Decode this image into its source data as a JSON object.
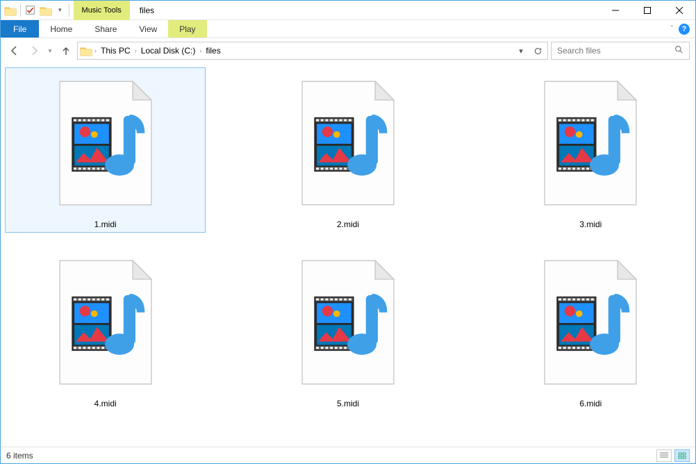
{
  "title_bar": {
    "contextual_tab_label": "Music Tools",
    "title": "files"
  },
  "ribbon": {
    "file": "File",
    "home": "Home",
    "share": "Share",
    "view": "View",
    "play": "Play"
  },
  "nav": {
    "breadcrumb": [
      {
        "label": "This PC"
      },
      {
        "label": "Local Disk (C:)"
      },
      {
        "label": "files"
      }
    ],
    "search_placeholder": "Search files"
  },
  "files": [
    {
      "name": "1.midi",
      "selected": true
    },
    {
      "name": "2.midi",
      "selected": false
    },
    {
      "name": "3.midi",
      "selected": false
    },
    {
      "name": "4.midi",
      "selected": false
    },
    {
      "name": "5.midi",
      "selected": false
    },
    {
      "name": "6.midi",
      "selected": false
    }
  ],
  "status": {
    "item_count": "6 items"
  }
}
